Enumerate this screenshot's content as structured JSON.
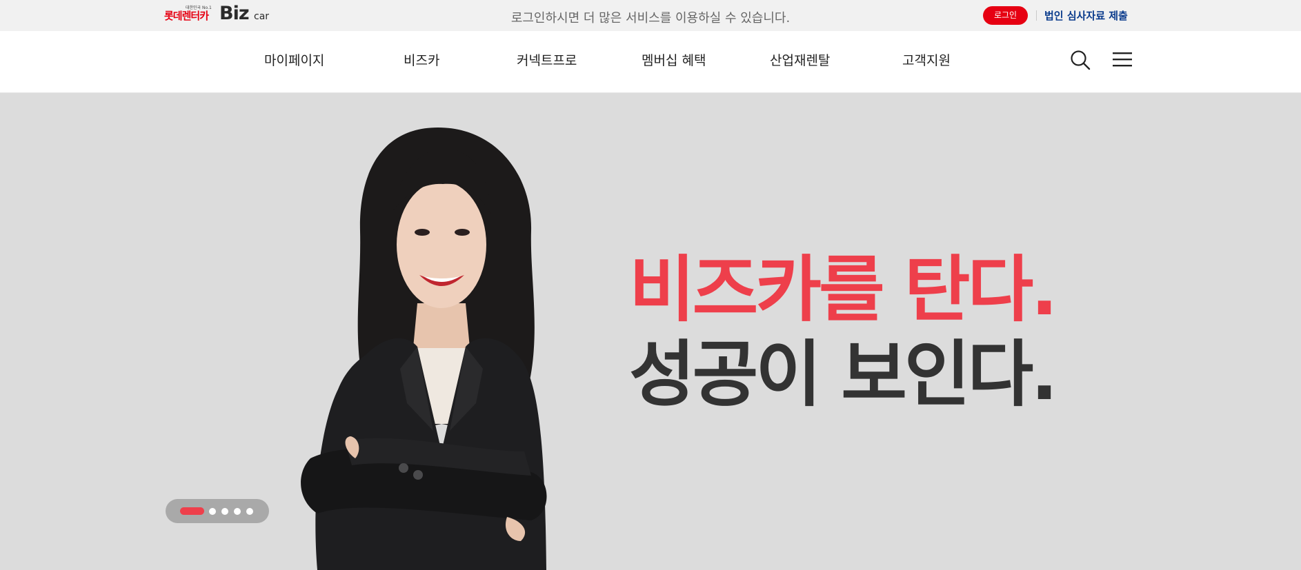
{
  "topbar": {
    "logo": {
      "korean": "롯데렌터카",
      "badge": "대한민국 No.1",
      "biz": "Biz",
      "car": "car"
    },
    "message": "로그인하시면 더 많은 서비스를 이용하실 수 있습니다.",
    "login_label": "로그인",
    "doc_link_label": "법인 심사자료 제출"
  },
  "nav": {
    "items": [
      {
        "label": "마이페이지"
      },
      {
        "label": "비즈카"
      },
      {
        "label": "커넥트프로"
      },
      {
        "label": "멤버십 혜택"
      },
      {
        "label": "산업재렌탈"
      },
      {
        "label": "고객지원"
      }
    ],
    "icons": [
      "search-icon",
      "menu-icon"
    ]
  },
  "hero": {
    "headline_line1": "비즈카를 탄다.",
    "headline_line2": "성공이 보인다.",
    "slider": {
      "total": 5,
      "active": 1
    }
  },
  "colors": {
    "brand_red": "#e60012",
    "headline_red": "#ee3f4b",
    "headline_dark": "#333333",
    "link_blue": "#0a3b8c",
    "hero_bg": "#dcdcdc",
    "topbar_bg": "#f1f1f1"
  }
}
